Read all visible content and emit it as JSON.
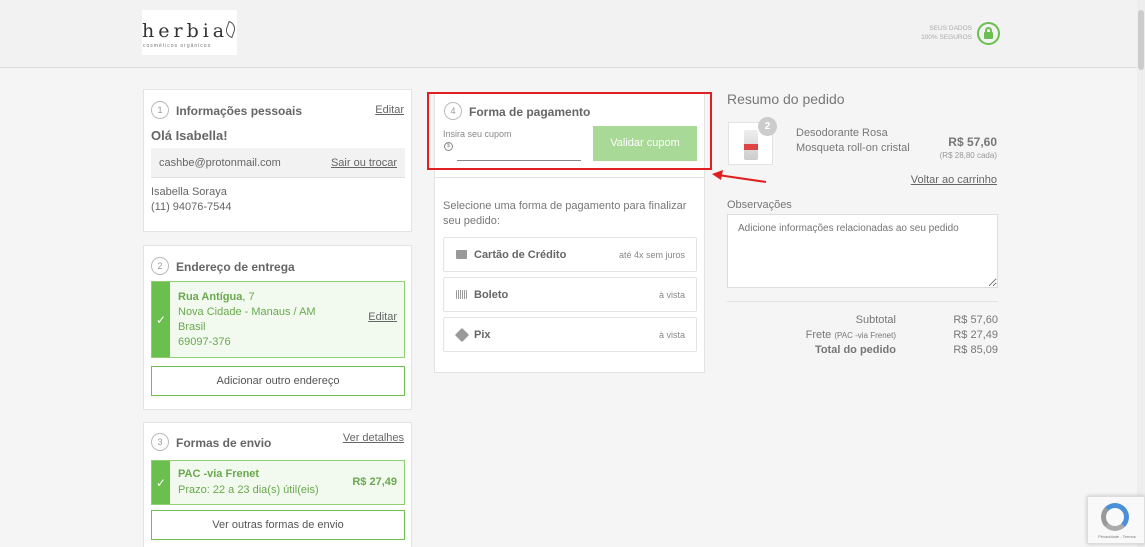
{
  "header": {
    "logo_text": "herbia",
    "logo_tagline": "cosméticos orgânicos",
    "secure_line1": "SEUS DADOS",
    "secure_line2": "100% SEGUROS"
  },
  "personal": {
    "step": "1",
    "title": "Informações pessoais",
    "edit": "Editar",
    "greeting": "Olá Isabella!",
    "email": "cashbe@protonmail.com",
    "switch_link": "Sair ou trocar",
    "name": "Isabella Soraya",
    "phone": "(11) 94076-7544"
  },
  "address": {
    "step": "2",
    "title": "Endereço de entrega",
    "street": "Rua Antígua",
    "number": ", 7",
    "city_line": "Nova Cidade - Manaus / AM",
    "country": "Brasil",
    "zip": "69097-376",
    "edit": "Editar",
    "add_button": "Adicionar outro endereço"
  },
  "shipping": {
    "step": "3",
    "title": "Formas de envio",
    "details_link": "Ver detalhes",
    "method": "PAC -via Frenet",
    "deadline": "Prazo: 22 a 23 dia(s) útil(eis)",
    "price": "R$ 27,49",
    "other_button": "Ver outras formas de envio"
  },
  "payment": {
    "step": "4",
    "title": "Forma de pagamento",
    "coupon_label": "Insira seu cupom",
    "coupon_value": "",
    "validate_button": "Validar cupom",
    "instruction": "Selecione uma forma de pagamento para finalizar seu pedido:",
    "options": [
      {
        "name": "Cartão de Crédito",
        "note": "até 4x sem juros",
        "icon": "credit-card-icon"
      },
      {
        "name": "Boleto",
        "note": "à vista",
        "icon": "barcode-icon"
      },
      {
        "name": "Pix",
        "note": "à vista",
        "icon": "pix-icon"
      }
    ]
  },
  "summary": {
    "title": "Resumo do pedido",
    "item_qty": "2",
    "item_name": "Desodorante Rosa Mosqueta roll-on cristal",
    "item_price": "R$ 57,60",
    "item_unit": "(R$ 28,80 cada)",
    "back_link": "Voltar ao carrinho",
    "notes_label": "Observações",
    "notes_placeholder": "Adicione informações relacionadas ao seu pedido",
    "subtotal_label": "Subtotal",
    "subtotal_value": "R$ 57,60",
    "shipping_label": "Frete",
    "shipping_detail": "(PAC -via Frenet)",
    "shipping_value": "R$ 27,49",
    "total_label": "Total do pedido",
    "total_value": "R$ 85,09"
  },
  "recaptcha": {
    "text": "Privacidade - Termos"
  },
  "colors": {
    "accent_green": "#6bbf4e",
    "annotation_red": "#e02020"
  }
}
